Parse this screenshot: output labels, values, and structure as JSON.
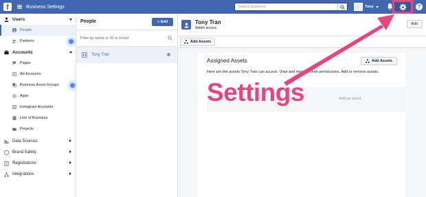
{
  "topbar": {
    "app_title": "Business Settings",
    "search_placeholder": "Search business",
    "profile_name": "Tony",
    "help_glyph": "?"
  },
  "sidebar": {
    "sections": [
      {
        "label": "Users",
        "icon": "users-icon",
        "expanded": true
      },
      {
        "label": "Accounts",
        "icon": "briefcase-icon",
        "expanded": true
      }
    ],
    "users_items": [
      {
        "label": "People",
        "icon": "person-icon",
        "active": true
      },
      {
        "label": "Partners",
        "icon": "partners-icon",
        "active": false
      }
    ],
    "accounts_items": [
      {
        "label": "Pages",
        "icon": "flag-icon"
      },
      {
        "label": "Ad Accounts",
        "icon": "ad-account-icon"
      },
      {
        "label": "Business Asset Groups",
        "icon": "asset-group-icon"
      },
      {
        "label": "Apps",
        "icon": "apps-icon"
      },
      {
        "label": "Instagram Accounts",
        "icon": "instagram-icon"
      },
      {
        "label": "Line of Business",
        "icon": "line-of-business-icon"
      },
      {
        "label": "Projects",
        "icon": "folder-icon"
      }
    ],
    "collapsed_sections": [
      {
        "label": "Data Sources",
        "icon": "data-sources-icon"
      },
      {
        "label": "Brand Safety",
        "icon": "shield-icon"
      },
      {
        "label": "Registrations",
        "icon": "registrations-icon"
      },
      {
        "label": "Integrations",
        "icon": "integrations-icon"
      }
    ]
  },
  "people": {
    "title": "People",
    "add_label": "+ Add",
    "filter_placeholder": "Filter by name or ID or Email",
    "rows": [
      {
        "name": "Tony Tran"
      }
    ]
  },
  "detail": {
    "name": "Tony Tran",
    "role": "Admin access",
    "edit_label": "Edit",
    "add_assets_tab": "Add Assets"
  },
  "assets": {
    "title": "Assigned Assets",
    "add_button": "Add Assets",
    "description": "Here are the assets Tony Tran can access. View and manage their permissions. Add or remove assets.",
    "empty_text": "Add an asset."
  },
  "annotation": {
    "label": "Settings",
    "color": "#e8457a"
  },
  "colors": {
    "brand": "#4267b2",
    "active_bg": "#edf2fa",
    "panel_bg": "#f5f6f7"
  }
}
